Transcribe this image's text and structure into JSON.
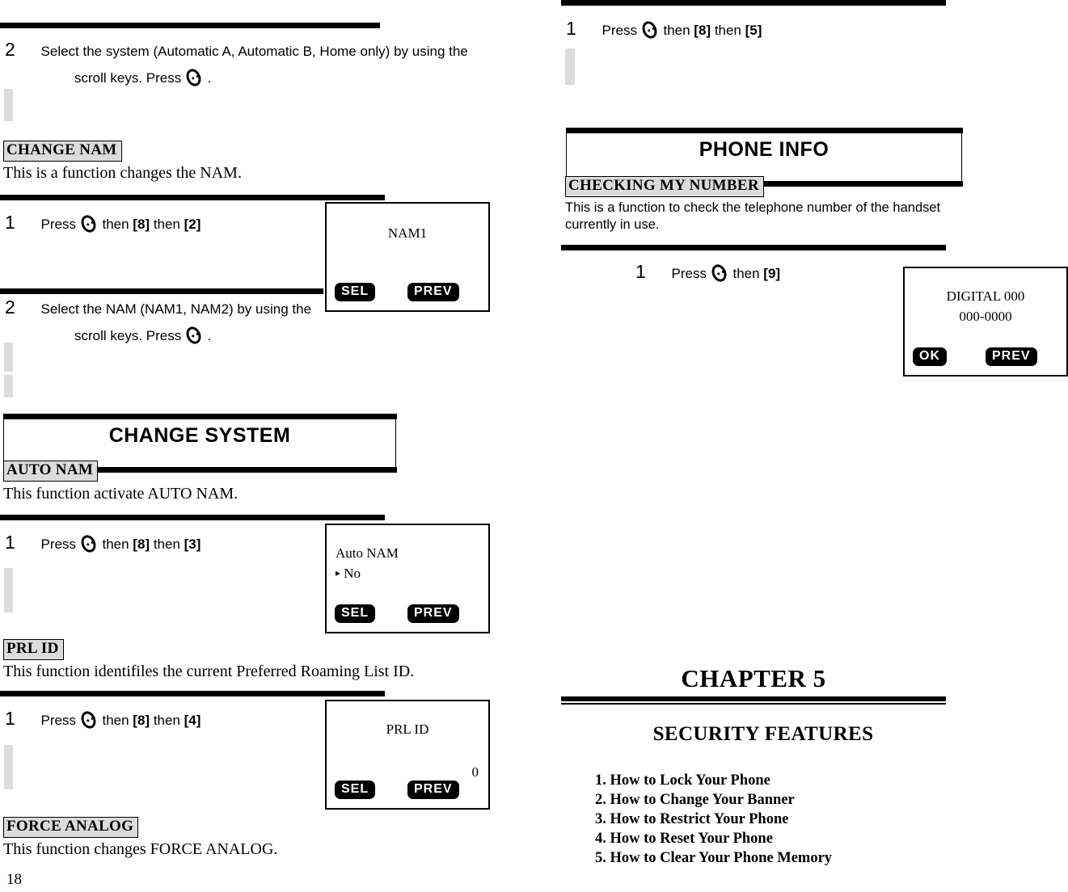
{
  "document": {
    "page_number": "18",
    "icon_ok_key": "ok-oval-key-icon"
  },
  "left_column": {
    "step_top": {
      "number": "2",
      "line1_pre": "Select the system",
      "line1_paren": "(Automatic A, Automatic B, Home only)",
      "line1_post": "by using the",
      "line2_pre": "scroll keys. Press",
      "line2_post": "."
    },
    "change_nam": {
      "label": "CHANGE NAM",
      "description": "This is a function changes the NAM.",
      "step1": {
        "number": "1",
        "pre": "Press",
        "mid": "then",
        "key1": "[8]",
        "mid2": "then",
        "key2": "[2]"
      },
      "screen": {
        "title": "NAM1",
        "softkey_left": "SEL",
        "softkey_right": "PREV"
      },
      "step2": {
        "number": "2",
        "line1_pre": "Select the NAM",
        "line1_paren": "(NAM1, NAM2)",
        "line1_post": "by using the",
        "line2_pre": "scroll keys. Press",
        "line2_post": "."
      }
    },
    "change_system_banner": {
      "title": "CHANGE SYSTEM"
    },
    "auto_nam": {
      "label": "AUTO NAM",
      "description": "This function activate AUTO NAM.",
      "step1": {
        "number": "1",
        "pre": "Press",
        "mid": "then",
        "key1": "[8]",
        "mid2": "then",
        "key2": "[3]"
      },
      "screen": {
        "line1": "Auto NAM",
        "line2_marker": "▸",
        "line2": "No",
        "softkey_left": "SEL",
        "softkey_right": "PREV"
      }
    },
    "prl_id": {
      "label": "PRL ID",
      "description": "This function identifiles the current Preferred Roaming List ID.",
      "step1": {
        "number": "1",
        "pre": "Press",
        "mid": "then",
        "key1": "[8]",
        "mid2": "then",
        "key2": "[4]"
      },
      "screen": {
        "title": "PRL ID",
        "value": "0",
        "softkey_left": "SEL",
        "softkey_right": "PREV"
      }
    },
    "force_analog": {
      "label": "FORCE ANALOG",
      "description": "This function changes FORCE ANALOG."
    }
  },
  "right_column": {
    "step_top": {
      "number": "1",
      "pre": "Press",
      "mid": "then",
      "key1": "[8]",
      "mid2": "then",
      "key2": "[5]"
    },
    "phone_info_banner": {
      "title": "PHONE INFO"
    },
    "checking_my_number": {
      "label": "CHECKING MY NUMBER",
      "description_line1": "This is a function to check the telephone number of the handset",
      "description_line2": "currently in use.",
      "step1": {
        "number": "1",
        "pre": "Press",
        "mid": "then",
        "key1": "[9]"
      },
      "screen": {
        "line1": "DIGITAL 000",
        "line2": "000-0000",
        "softkey_left": "OK",
        "softkey_right": "PREV"
      }
    },
    "chapter": {
      "heading": "CHAPTER 5",
      "subtitle": "SECURITY FEATURES",
      "contents": [
        "1. How to Lock Your Phone",
        "2. How to Change Your Banner",
        "3. How to Restrict Your Phone",
        "4. How to Reset Your Phone",
        "5. How to Clear Your Phone Memory"
      ]
    }
  },
  "colors": {
    "ink": "#000000",
    "paper": "#ffffff",
    "highlight_gray": "#dcdcdc"
  }
}
